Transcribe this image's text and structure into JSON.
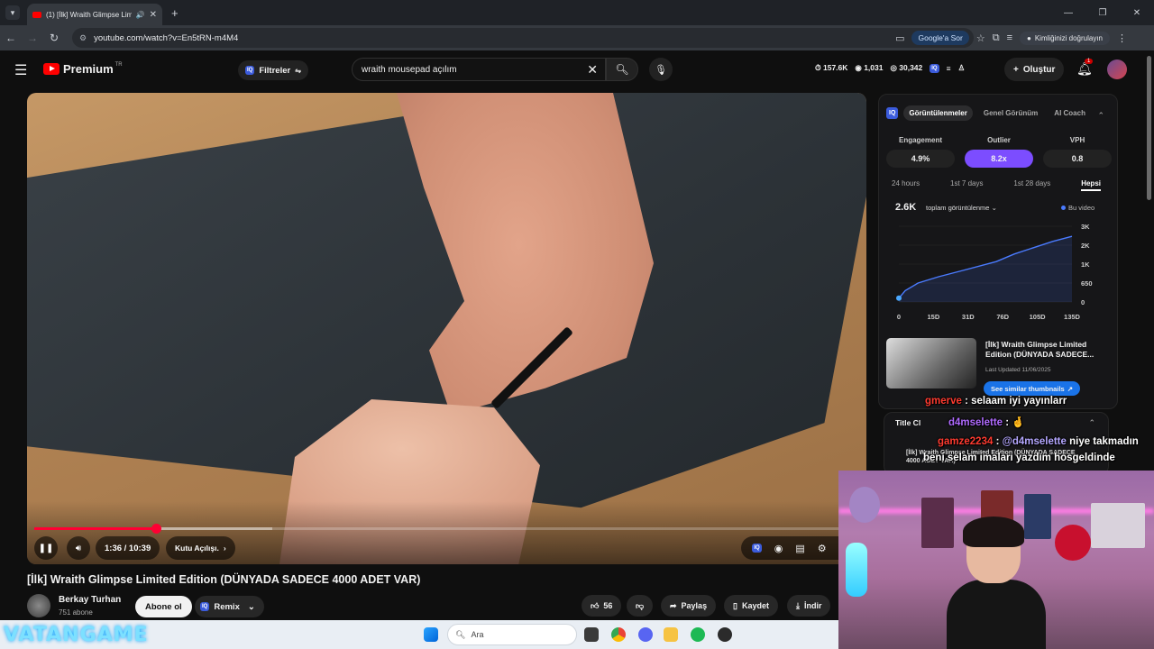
{
  "browser": {
    "tab_title": "(1) [İlk] Wraith Glimpse Lim",
    "url": "youtube.com/watch?v=En5tRN-m4M4",
    "google_ask": "Google'a Sor",
    "verify": "Kimliğinizi doğrulayın"
  },
  "header": {
    "logo": "Premium",
    "region": "TR",
    "filters": "Filtreler",
    "search_value": "wraith mousepad açılım",
    "stats": [
      "157.6K",
      "1,031",
      "30,342"
    ],
    "create": "Oluştur",
    "notif_count": "1"
  },
  "player": {
    "time": "1:36 / 10:39",
    "chapter": "Kutu Açılışı.",
    "progress": 0.148,
    "buffered": 0.29
  },
  "video": {
    "title": "[İlk] Wraith Glimpse Limited Edition (DÜNYADA SADECE 4000 ADET VAR)",
    "channel": "Berkay Turhan",
    "subs": "751 abone",
    "subscribe": "Abone ol",
    "remix": "Remix",
    "likes": "56",
    "share": "Paylaş",
    "save": "Kaydet",
    "download": "İndir"
  },
  "panel": {
    "tabs": [
      "Görüntülenmeler",
      "Genel Görünüm",
      "AI Coach"
    ],
    "metrics": [
      {
        "label": "Engagement",
        "value": "4.9%"
      },
      {
        "label": "Outlier",
        "value": "8.2x"
      },
      {
        "label": "VPH",
        "value": "0.8"
      }
    ],
    "periods": [
      "24 hours",
      "1st 7 days",
      "1st 28 days",
      "Hepsi"
    ],
    "view_count": "2.6K",
    "view_select": "toplam görüntülenme",
    "legend": "Bu video",
    "thumb_title": "[İlk] Wraith Glimpse Limited Edition (DÜNYADA SADECE...",
    "last_updated": "Last Updated 11/06/2025",
    "similar": "See similar thumbnails",
    "title_checker": "Title Cl",
    "title_inner": "[İlk] Wraith Glimpse Limited Edition (DÜNYADA SADECE 4000 ADET VAR)"
  },
  "chart_data": {
    "type": "line",
    "x_ticks": [
      "0",
      "15D",
      "31D",
      "76D",
      "105D",
      "135D"
    ],
    "y_ticks": [
      "3K",
      "2K",
      "1K",
      "650",
      "0"
    ],
    "series": [
      {
        "name": "Bu video",
        "x": [
          0,
          5,
          15,
          31,
          50,
          76,
          90,
          105,
          120,
          135
        ],
        "y": [
          150,
          450,
          750,
          1000,
          1250,
          1600,
          1900,
          2150,
          2400,
          2600
        ]
      }
    ],
    "ylim": [
      0,
      3000
    ]
  },
  "chat": [
    {
      "user": "gmerve",
      "text": " : selaam iyi yayınlarr"
    },
    {
      "user": "d4mselette",
      "text": " : 🤞"
    },
    {
      "user": "gamze2234",
      "mention": "@d4mselette",
      "text": " niye takmadın"
    },
    {
      "user": "",
      "text": "beni selam imaları yazdım hosgeldinde"
    }
  ],
  "taskbar": {
    "search": "Ara"
  },
  "watermark": "VATANGAME"
}
